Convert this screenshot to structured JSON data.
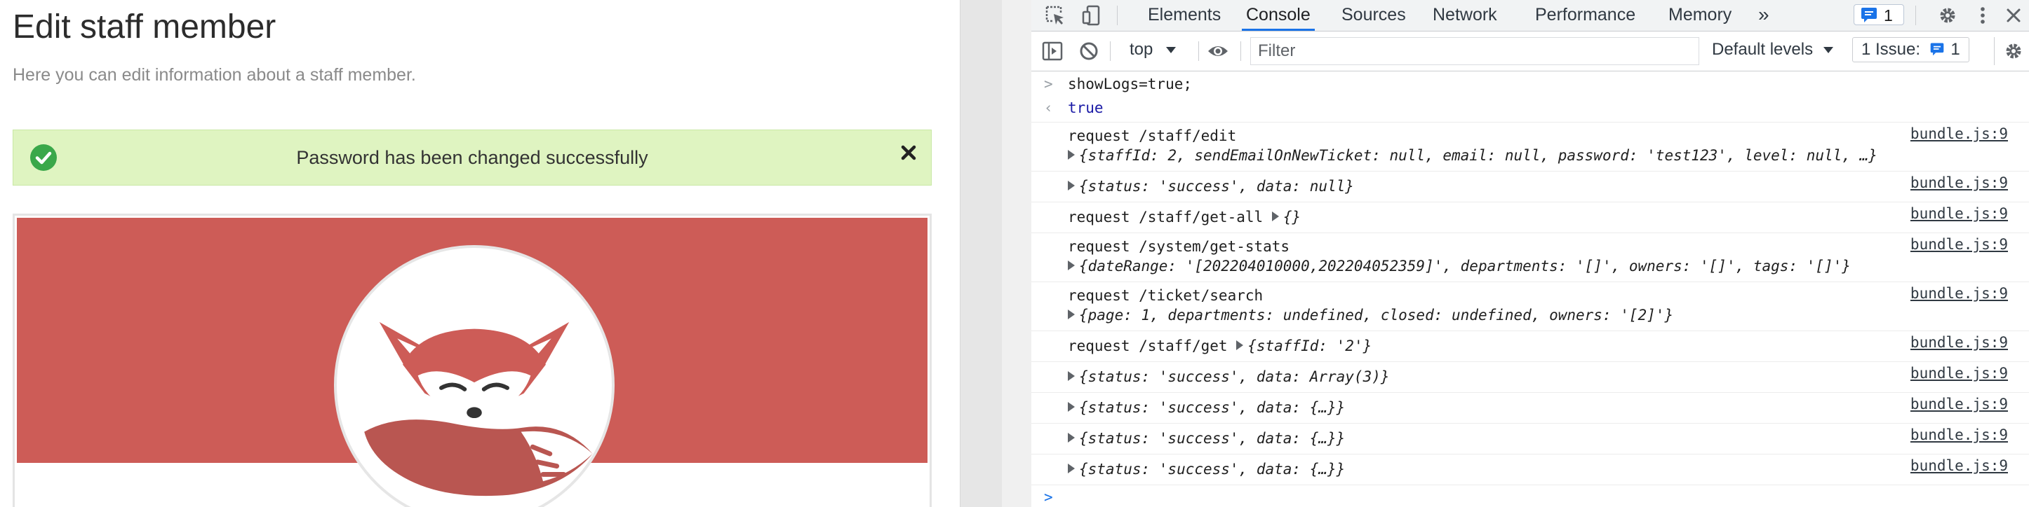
{
  "app": {
    "title": "Edit staff member",
    "subtitle": "Here you can edit information about a staff member.",
    "alert": {
      "message": "Password has been changed successfully",
      "close": "×"
    },
    "brand_color": "#cd5c57"
  },
  "devtools": {
    "tabs": [
      "Elements",
      "Console",
      "Sources",
      "Network",
      "Performance",
      "Memory"
    ],
    "active_tab": "Console",
    "more_tabs": "»",
    "message_badge_count": "1",
    "toolbar": {
      "context": "top",
      "filter_placeholder": "Filter",
      "levels": "Default levels",
      "issues_label": "1 Issue:",
      "issues_count": "1"
    },
    "console": {
      "input_command": "showLogs=true;",
      "input_result": "true",
      "source": "bundle.js:9",
      "entries": [
        {
          "request": "request /staff/edit",
          "object": "{staffId: 2, sendEmailOnNewTicket: null, email: null, password: 'test123', level: null, …}"
        },
        {
          "object": "{status: 'success', data: null}"
        },
        {
          "request": "request /staff/get-all",
          "object": "{}"
        },
        {
          "request": "request /system/get-stats",
          "object": "{dateRange: '[202204010000,202204052359]', departments: '[]', owners: '[]', tags: '[]'}"
        },
        {
          "request": "request /ticket/search",
          "object": "{page: 1, departments: undefined, closed: undefined, owners: '[2]'}"
        },
        {
          "request": "request /staff/get",
          "object": "{staffId: '2'}"
        },
        {
          "object": "{status: 'success', data: Array(3)}"
        },
        {
          "object": "{status: 'success', data: {…}}"
        },
        {
          "object": "{status: 'success', data: {…}}"
        },
        {
          "object": "{status: 'success', data: {…}}"
        }
      ]
    },
    "colors": {
      "accent": "#1a73e8",
      "string": "#c41a16",
      "number": "#1a1aa6"
    }
  }
}
